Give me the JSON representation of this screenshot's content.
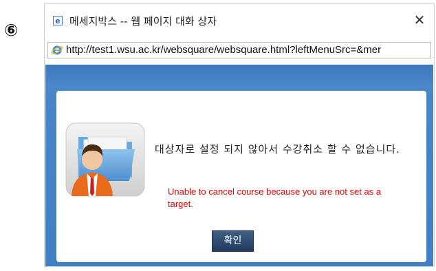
{
  "step_marker": "⑥",
  "window": {
    "title": "메세지박스 -- 웹 페이지 대화 상자",
    "close_label": "✕",
    "address_url": "http://test1.wsu.ac.kr/websquare/websquare.html?leftMenuSrc=&mer"
  },
  "dialog": {
    "message_ko": "대상자로 설정 되지 않아서 수강취소 할 수 없습니다.",
    "message_en": "Unable to cancel course because you are not set as a target.",
    "ok_label": "확인",
    "icon": "user-folder-icon"
  },
  "colors": {
    "dialog_background": "#4a86c8",
    "ok_button": "#2b4a72",
    "english_text": "#e00000"
  }
}
